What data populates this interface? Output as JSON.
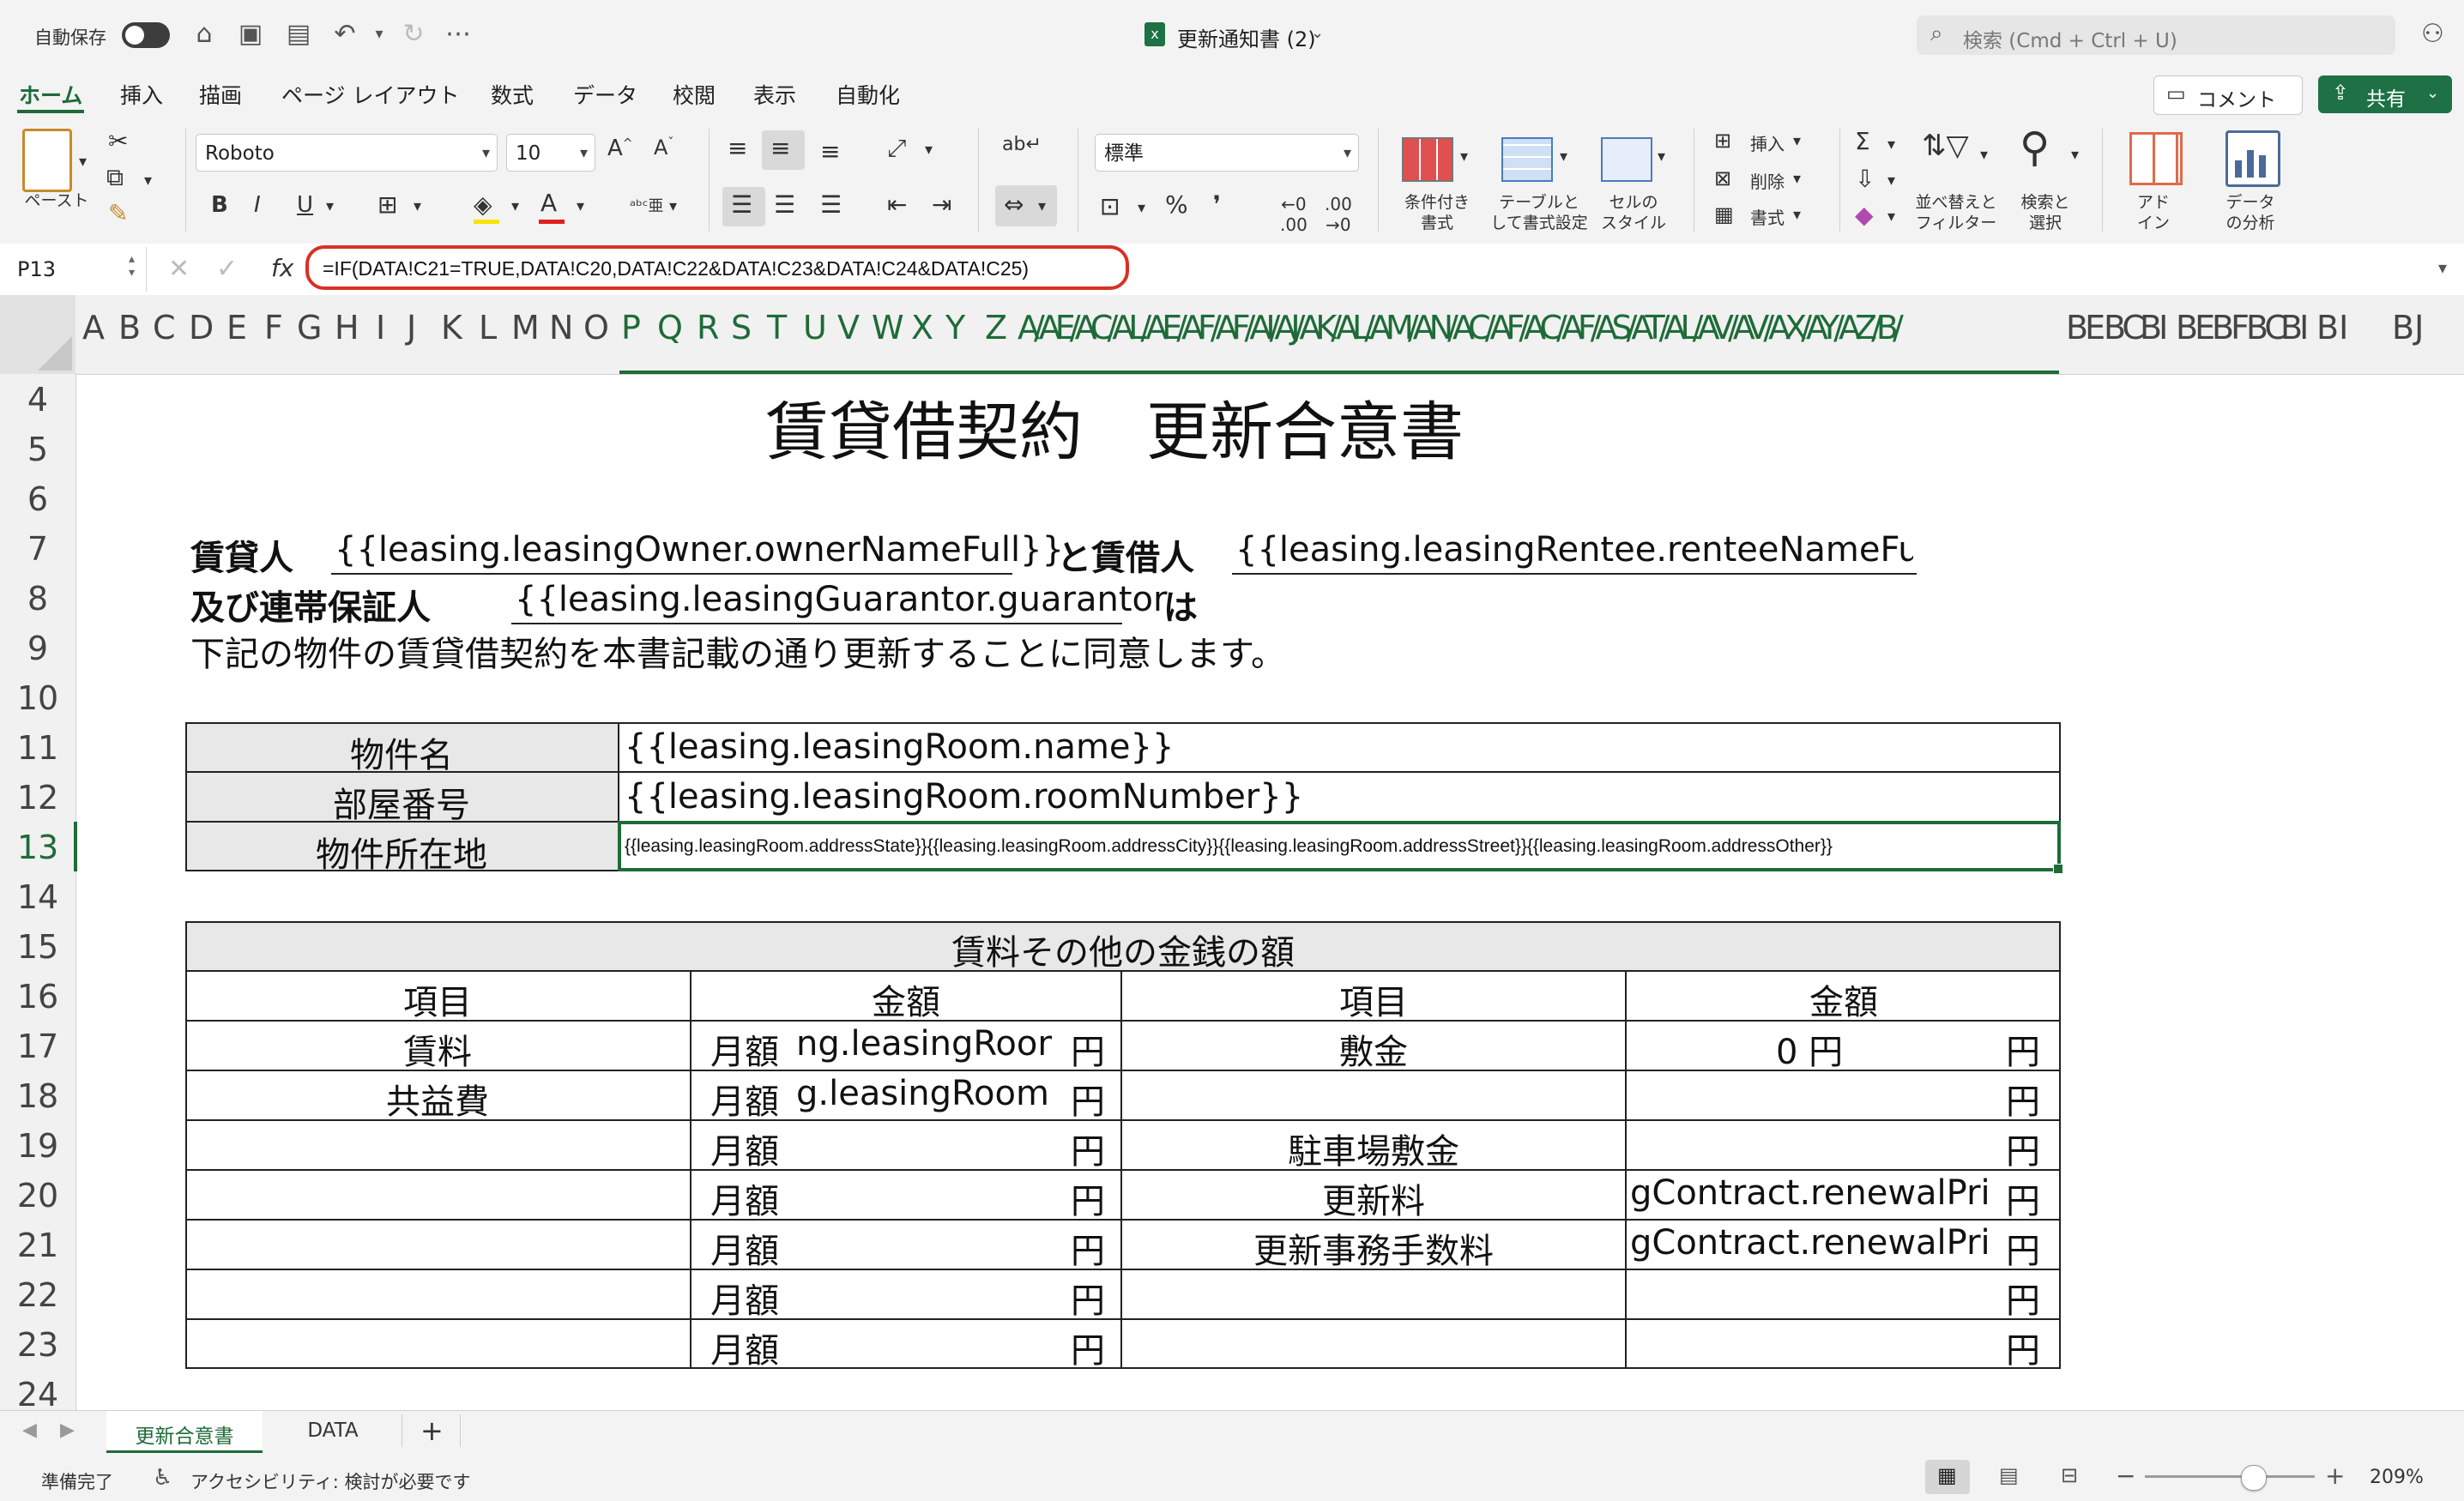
{
  "titlebar": {
    "autosave_label": "自動保存",
    "file_title": "更新通知書 (2)",
    "search_placeholder": "検索 (Cmd + Ctrl + U)"
  },
  "tabs": [
    "ホーム",
    "挿入",
    "描画",
    "ページ レイアウト",
    "数式",
    "データ",
    "校閲",
    "表示",
    "自動化"
  ],
  "ribbon": {
    "comment_label": "コメント",
    "share_label": "共有",
    "paste_label": "ペースト",
    "font_name": "Roboto",
    "font_size": "10",
    "number_format": "標準",
    "cond_format_label": "条件付き\n書式",
    "table_format_label": "テーブルと\nして書式設定",
    "cell_style_label": "セルの\nスタイル",
    "insert_label": "挿入",
    "delete_label": "削除",
    "format_label": "書式",
    "sort_filter_label": "並べ替えと\nフィルター",
    "find_select_label": "検索と\n選択",
    "addin_label": "アド\nイン",
    "analyze_label": "データ\nの分析",
    "bold": "B",
    "italic": "I",
    "underline": "U"
  },
  "formula_bar": {
    "name_box": "P13",
    "fx_label": "fx",
    "formula": "=IF(DATA!C21=TRUE,DATA!C20,DATA!C22&DATA!C23&DATA!C24&DATA!C25)"
  },
  "columns": [
    "A",
    "B",
    "C",
    "D",
    "E",
    "F",
    "G",
    "H",
    "I",
    "J",
    "K",
    "L",
    "M",
    "N",
    "O",
    "P",
    "Q",
    "R",
    "S",
    "T",
    "U",
    "V",
    "W",
    "X",
    "Y",
    "Z",
    "A/AE/AC/AL/AE/AF/AF/AI/AJ/AK/AL/AM/AN/AC/AF/AC/AF/AS/AT/AL/AV/AV/AX/AY/AZ/B/",
    "BE",
    "BC",
    "BI",
    "BE",
    "BF",
    "BC",
    "BI",
    "BI",
    "BJ"
  ],
  "rows": [
    "4",
    "5",
    "6",
    "7",
    "8",
    "9",
    "10",
    "11",
    "12",
    "13",
    "14",
    "15",
    "16",
    "17",
    "18",
    "19",
    "20",
    "21",
    "22",
    "23",
    "24"
  ],
  "sheet": {
    "title": "賃貸借契約　更新合意書",
    "lessor_label": "賃貸人",
    "lessor_value": "{{leasing.leasingOwner.ownerNameFull}}",
    "and_lessee_label": "と賃借人",
    "lessee_value": "{{leasing.leasingRentee.renteeNameFull}",
    "guarantor_label": "及び連帯保証人",
    "guarantor_value": "{{leasing.leasingGuarantor.guarantor",
    "ha": "は",
    "agreement_line": "下記の物件の賃貸借契約を本書記載の通り更新することに同意します。",
    "property_rows": [
      {
        "label": "物件名",
        "value": "{{leasing.leasingRoom.name}}"
      },
      {
        "label": "部屋番号",
        "value": "{{leasing.leasingRoom.roomNumber}}"
      },
      {
        "label": "物件所在地",
        "value": "{{leasing.leasingRoom.addressState}}{{leasing.leasingRoom.addressCity}}{{leasing.leasingRoom.addressStreet}}{{leasing.leasingRoom.addressOther}}"
      }
    ],
    "money_title": "賃料その他の金銭の額",
    "money_headers": [
      "項目",
      "金額",
      "項目",
      "金額"
    ],
    "money_rows": [
      {
        "item1": "賃料",
        "monthly": "月額",
        "amount1": "ng.leasingRoom",
        "yen1": "円",
        "item2": "敷金",
        "amount2": "0 円",
        "yen2": "円"
      },
      {
        "item1": "共益費",
        "monthly": "月額",
        "amount1": "g.leasingRoom.l",
        "yen1": "円",
        "item2": "",
        "amount2": "",
        "yen2": "円"
      },
      {
        "item1": "",
        "monthly": "月額",
        "amount1": "",
        "yen1": "円",
        "item2": "駐車場敷金",
        "amount2": "",
        "yen2": "円"
      },
      {
        "item1": "",
        "monthly": "月額",
        "amount1": "",
        "yen1": "円",
        "item2": "更新料",
        "amount2": "gContract.renewalPrice",
        "yen2": "円"
      },
      {
        "item1": "",
        "monthly": "月額",
        "amount1": "",
        "yen1": "円",
        "item2": "更新事務手数料",
        "amount2": "gContract.renewalPrice",
        "yen2": "円"
      },
      {
        "item1": "",
        "monthly": "月額",
        "amount1": "",
        "yen1": "円",
        "item2": "",
        "amount2": "",
        "yen2": "円"
      },
      {
        "item1": "",
        "monthly": "月額",
        "amount1": "",
        "yen1": "円",
        "item2": "",
        "amount2": "",
        "yen2": "円"
      }
    ]
  },
  "sheet_tabs": [
    "更新合意書",
    "DATA"
  ],
  "status": {
    "ready": "準備完了",
    "accessibility": "アクセシビリティ: 検討が必要です",
    "zoom": "209%"
  },
  "colors": {
    "accent": "#1e6b38",
    "header_fill": "#e8e8e8",
    "formula_highlight": "#d93025"
  }
}
